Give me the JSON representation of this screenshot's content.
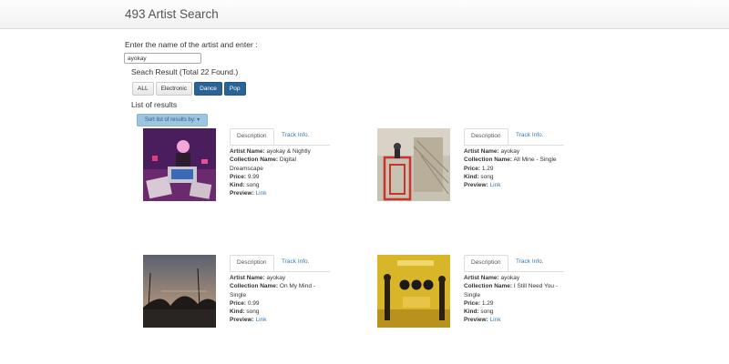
{
  "app": {
    "title": "493 Artist Search"
  },
  "search": {
    "prompt": "Enter the name of the artist and enter :",
    "value": "ayokay"
  },
  "results": {
    "summary": "Seach Result (Total 22 Found.)"
  },
  "filters": [
    {
      "label": "ALL",
      "active": false
    },
    {
      "label": "Electronic",
      "active": false
    },
    {
      "label": "Dance",
      "active": true
    },
    {
      "label": "Pop",
      "active": true
    }
  ],
  "list": {
    "title": "List of results",
    "sort_label": "Sort list of results by: ▾"
  },
  "labels": {
    "tab_description": "Description",
    "tab_track": "Track Info.",
    "artist_name": "Artist Name:",
    "collection_name": "Collection Name:",
    "price": "Price:",
    "kind": "Kind:",
    "preview": "Preview:",
    "preview_link": "Link"
  },
  "cards": [
    {
      "artist": "ayokay & Nightly",
      "collection": "Digital Dreamscape",
      "price": "9.99",
      "kind": "song"
    },
    {
      "artist": "ayokay",
      "collection": "All Mine - Single",
      "price": "1.29",
      "kind": "song"
    },
    {
      "artist": "ayokay",
      "collection": "On My Mind - Single",
      "price": "0.99",
      "kind": "song"
    },
    {
      "artist": "ayokay",
      "collection": "I Still Need You - Single",
      "price": "1.29",
      "kind": "song"
    }
  ]
}
